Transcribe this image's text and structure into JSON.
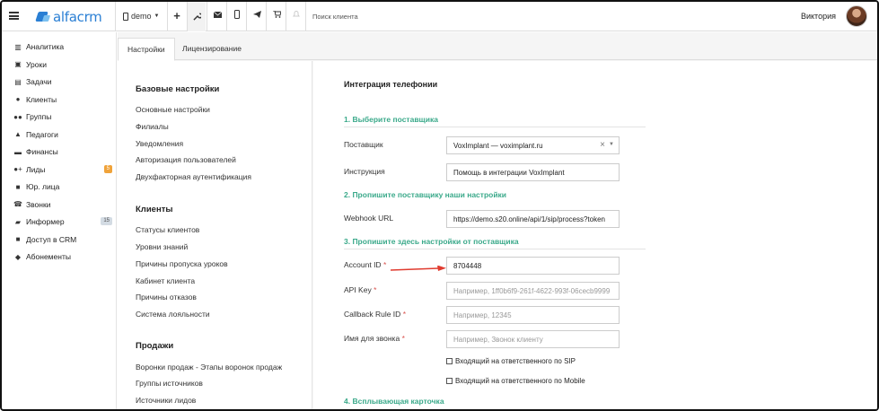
{
  "topbar": {
    "brand": "alfacrm",
    "branch": "demo",
    "search_placeholder": "Поиск клиента",
    "user_name": "Виктория",
    "icons": [
      "plus-icon",
      "wrench-icon",
      "envelope-icon",
      "phone-icon",
      "telegram-icon",
      "cart-icon",
      "bell-icon"
    ]
  },
  "sidebar": {
    "items": [
      {
        "label": "Аналитика",
        "icon": "book-icon"
      },
      {
        "label": "Уроки",
        "icon": "calendar-icon"
      },
      {
        "label": "Задачи",
        "icon": "tasks-icon"
      },
      {
        "label": "Клиенты",
        "icon": "user-icon"
      },
      {
        "label": "Группы",
        "icon": "users-icon"
      },
      {
        "label": "Педагоги",
        "icon": "graduation-icon"
      },
      {
        "label": "Финансы",
        "icon": "money-icon"
      },
      {
        "label": "Лиды",
        "icon": "user-plus-icon",
        "badge": "5"
      },
      {
        "label": "Юр. лица",
        "icon": "briefcase-icon"
      },
      {
        "label": "Звонки",
        "icon": "phone-icon"
      },
      {
        "label": "Информер",
        "icon": "inbox-icon",
        "badge": "15"
      },
      {
        "label": "Доступ в CRM",
        "icon": "lock-icon"
      },
      {
        "label": "Абонементы",
        "icon": "tag-icon"
      }
    ]
  },
  "tabs": [
    {
      "label": "Настройки",
      "active": true
    },
    {
      "label": "Лицензирование",
      "active": false
    }
  ],
  "settings_menu": {
    "sections": [
      {
        "title": "Базовые настройки",
        "links": [
          "Основные настройки",
          "Филиалы",
          "Уведомления",
          "Авторизация пользователей",
          "Двухфакторная аутентификация"
        ]
      },
      {
        "title": "Клиенты",
        "links": [
          "Статусы клиентов",
          "Уровни знаний",
          "Причины пропуска уроков",
          "Кабинет клиента",
          "Причины отказов",
          "Система лояльности"
        ]
      },
      {
        "title": "Продажи",
        "links": [
          "Воронки продаж - Этапы воронок продаж",
          "Группы источников",
          "Источники лидов"
        ]
      }
    ]
  },
  "telephony": {
    "title": "Интеграция телефонии",
    "step1": "1. Выберите поставщика",
    "provider_label": "Поставщик",
    "provider_value": "VoxImplant — voximplant.ru",
    "instruction_label": "Инструкция",
    "instruction_value": "Помощь в интеграции VoxImplant",
    "step2": "2. Пропишите поставщику наши настройки",
    "webhook_label": "Webhook URL",
    "webhook_value": "https://demo.s20.online/api/1/sip/process?token",
    "step3": "3. Пропишите здесь настройки от поставщика",
    "account_label": "Account ID",
    "account_value": "8704448",
    "apikey_label": "API Key",
    "apikey_placeholder": "Например, 1ff0b6f9-261f-4622-993f-06cecb9999",
    "callback_label": "Callback Rule ID",
    "callback_placeholder": "Например, 12345",
    "callname_label": "Имя для звонка",
    "callname_placeholder": "Например, Звонок клиенту",
    "check_sip": "Входящий на ответственного по SIP",
    "check_mobile": "Входящий на ответственного по Mobile",
    "step4": "4. Всплывающая карточка",
    "required_mark": "*"
  },
  "colors": {
    "accent": "#2a7fd4",
    "step": "#3aa98a",
    "arrow": "#e03b2f",
    "badge_orange": "#f0a33a"
  }
}
